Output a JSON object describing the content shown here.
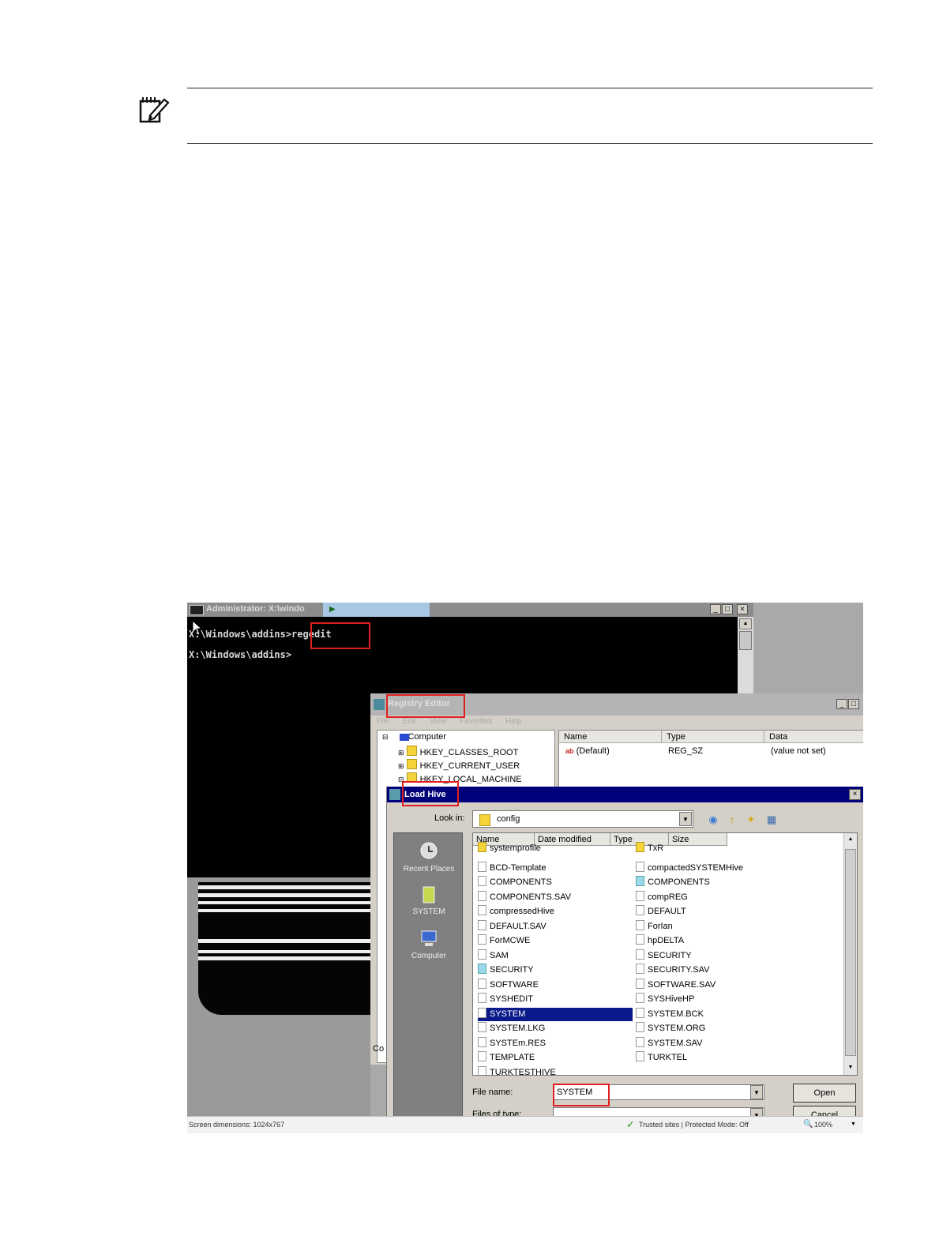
{
  "screenshot": {
    "cmd": {
      "title": "Administrator: X:\\windo",
      "tab_link": "",
      "lines": [
        "X:\\Windows\\addins>regedit",
        "X:\\Windows\\addins>"
      ]
    },
    "registry": {
      "title": "Registry Editor",
      "menu": "File Edit View Favorites Help",
      "tree": [
        "Computer",
        "HKEY_CLASSES_ROOT",
        "HKEY_CURRENT_USER",
        "HKEY_LOCAL_MACHINE"
      ],
      "columns": [
        "Name",
        "Type",
        "Data"
      ],
      "row": {
        "name": "(Default)",
        "type": "REG_SZ",
        "data": "(value not set)"
      },
      "bottom_partial": "Co"
    },
    "load_hive": {
      "title": "Load Hive",
      "look_in_label": "Look in:",
      "look_in_value": "config",
      "places": [
        "Recent Places",
        "SYSTEM",
        "Computer"
      ],
      "columns": [
        "Name",
        "Date modified",
        "Type",
        "Size"
      ],
      "files_left": [
        "systemprofile",
        "BCD-Template",
        "COMPONENTS",
        "COMPONENTS.SAV",
        "compressedHive",
        "DEFAULT.SAV",
        "ForMCWE",
        "SAM",
        "SECURITY",
        "SOFTWARE",
        "SYSHEDIT",
        "SYSTEM",
        "SYSTEM.LKG",
        "SYSTEm.RES",
        "TEMPLATE",
        "TURKTESTHIVE"
      ],
      "files_right": [
        "TxR",
        "compactedSYSTEMHive",
        "COMPONENTS",
        "compREG",
        "DEFAULT",
        "ForIan",
        "hpDELTA",
        "SECURITY",
        "SECURITY.SAV",
        "SOFTWARE.SAV",
        "SYSHiveHP",
        "SYSTEM.BCK",
        "SYSTEM.ORG",
        "SYSTEM.SAV",
        "TURKTEL"
      ],
      "file_name_label": "File name:",
      "file_name_value": "SYSTEM",
      "file_type_label": "Files of type:",
      "open_button": "Open",
      "cancel_button": "Cancel"
    },
    "status": {
      "left": "Screen dimensions: 1024x767",
      "middle": "Trusted sites | Protected Mode: Off",
      "zoom": "100%"
    }
  }
}
